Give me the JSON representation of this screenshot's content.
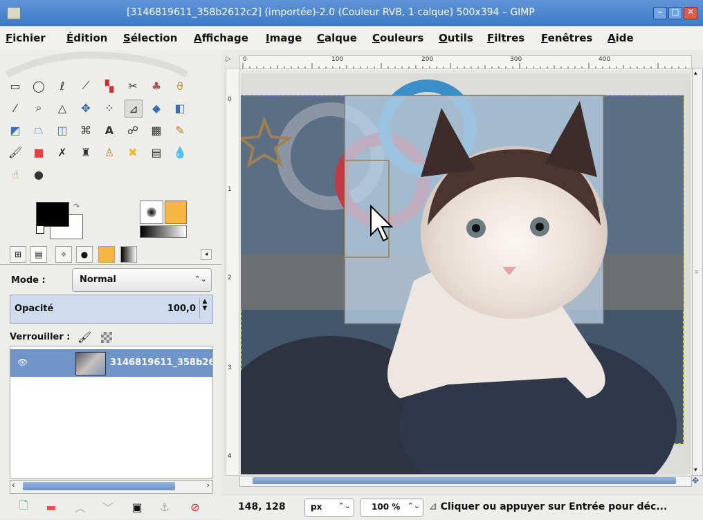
{
  "window": {
    "title": "[3146819611_358b2612c2] (importée)-2.0 (Couleur RVB, 1 calque) 500x394 – GIMP"
  },
  "menu": [
    "Fichier",
    "Édition",
    "Sélection",
    "Affichage",
    "Image",
    "Calque",
    "Couleurs",
    "Outils",
    "Filtres",
    "Fenêtres",
    "Aide"
  ],
  "layers_panel": {
    "mode_label": "Mode :",
    "mode_value": "Normal",
    "opacity_label": "Opacité",
    "opacity_value": "100,0",
    "lock_label": "Verrouiller :",
    "layer_name": "3146819611_358b26"
  },
  "rulers": {
    "horizontal": [
      "0",
      "100",
      "200",
      "300",
      "400"
    ],
    "vertical": [
      "0",
      "1",
      "2",
      "3",
      "4"
    ]
  },
  "status": {
    "coords": "148, 128",
    "unit": "px",
    "zoom": "100 %",
    "message": "Cliquer ou appuyer sur Entrée pour déc..."
  },
  "icons": {
    "tools": [
      "rect-select-icon",
      "ellipse-select-icon",
      "free-select-icon",
      "fuzzy-select-icon",
      "color-select-icon",
      "scissors-icon",
      "foreground-select-icon",
      "paths-icon",
      "color-picker-icon",
      "zoom-icon",
      "measure-icon",
      "move-icon",
      "align-icon",
      "crop-icon",
      "rotate-icon",
      "scale-icon",
      "shear-icon",
      "perspective-icon",
      "flip-icon",
      "text-icon",
      "blend-icon",
      "pencil-icon",
      "paintbrush-icon",
      "eraser-icon",
      "airbrush-icon",
      "ink-icon",
      "clone-icon",
      "heal-icon",
      "perspective-clone-icon",
      "blur-icon",
      "smudge-icon",
      "dodge-icon"
    ]
  },
  "colors": {
    "accent": "#6f95c8",
    "foreground": "#000000",
    "background": "#ffffff",
    "pattern": "#f7b63f"
  }
}
